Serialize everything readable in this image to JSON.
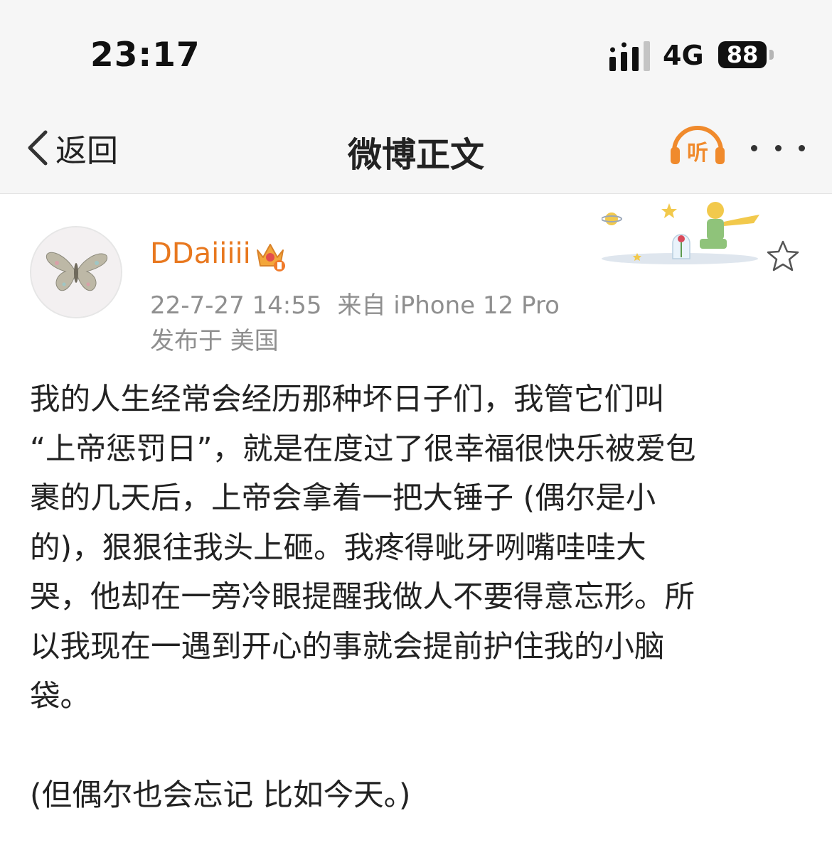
{
  "status_bar": {
    "time": "23:17",
    "network": "4G",
    "battery": "88"
  },
  "nav": {
    "back_label": "返回",
    "title": "微博正文",
    "listen_label": "听"
  },
  "post": {
    "username": "DDaiiiii",
    "timestamp": "22-7-27 14:55",
    "source": "来自 iPhone 12 Pro",
    "location": "发布于 美国",
    "lines": [
      "我的人生经常会经历那种坏日子们，我管它们叫",
      "“上帝惩罚日”，就是在度过了很幸福很快乐被爱包",
      "裹的几天后，上帝会拿着一把大锤子 (偶尔是小",
      "的)，狠狠往我头上砸。我疼得呲牙咧嘴哇哇大",
      "哭，他却在一旁冷眼提醒我做人不要得意忘形。所",
      "以我现在一遇到开心的事就会提前护住我的小脑",
      "袋。",
      "",
      "(但偶尔也会忘记 比如今天。)"
    ]
  },
  "colors": {
    "accent_orange": "#e8781f",
    "meta_gray": "#8f8f8f",
    "header_bg": "#f6f6f6"
  },
  "icons": [
    "back-chevron-icon",
    "listen-headphones-icon",
    "more-icon",
    "vip-crown-icon",
    "star-icon",
    "butterfly-avatar",
    "little-prince-decoration"
  ]
}
